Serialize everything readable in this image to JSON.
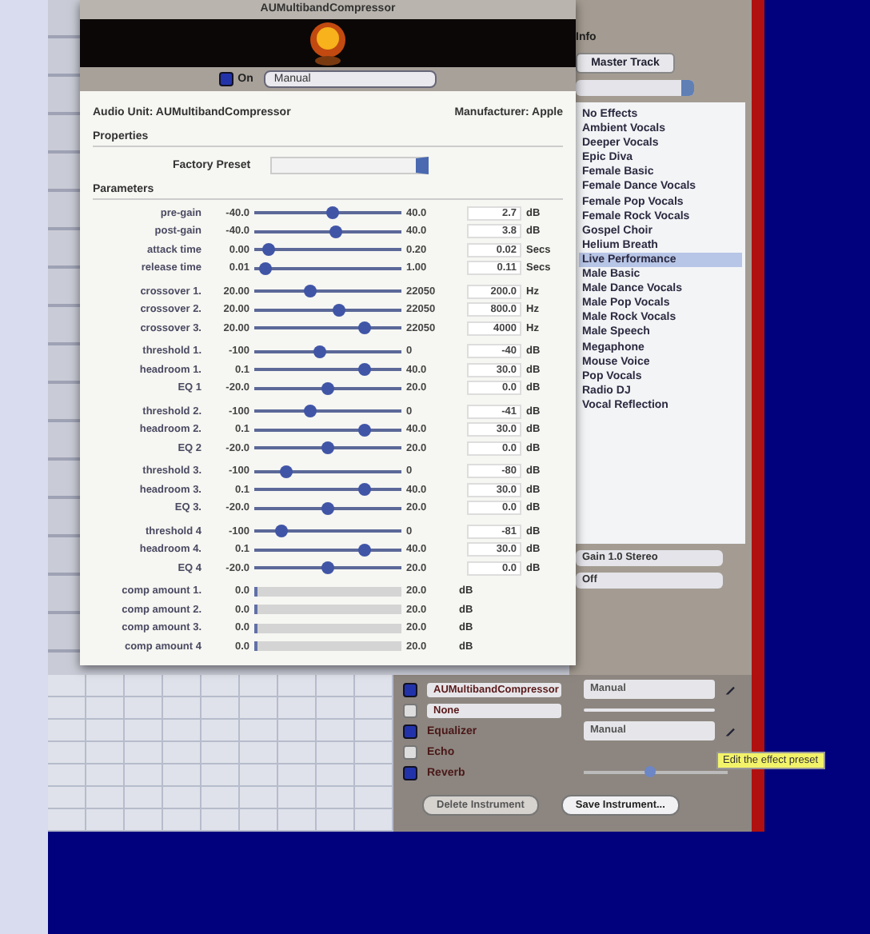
{
  "au_window": {
    "title": "AUMultibandCompressor",
    "on": {
      "label": "On",
      "checked": true
    },
    "preset_menu": "Manual",
    "audio_unit": "Audio Unit: AUMultibandCompressor",
    "manufacturer": "Manufacturer: Apple",
    "properties_heading": "Properties",
    "factory_preset_label": "Factory Preset",
    "parameters_heading": "Parameters",
    "parameter_groups": [
      [
        {
          "label": "pre-gain",
          "min": "-40.0",
          "max": "40.0",
          "level": 0.53,
          "value": "2.7",
          "unit": "dB"
        },
        {
          "label": "post-gain",
          "min": "-40.0",
          "max": "40.0",
          "level": 0.55,
          "value": "3.8",
          "unit": "dB"
        },
        {
          "label": "attack time",
          "min": "0.00",
          "max": "0.20",
          "level": 0.1,
          "value": "0.02",
          "unit": "Secs"
        },
        {
          "label": "release time",
          "min": "0.01",
          "max": "1.00",
          "level": 0.08,
          "value": "0.11",
          "unit": "Secs"
        }
      ],
      [
        {
          "label": "crossover 1.",
          "min": "20.00",
          "max": "22050",
          "level": 0.38,
          "value": "200.0",
          "unit": "Hz"
        },
        {
          "label": "crossover 2.",
          "min": "20.00",
          "max": "22050",
          "level": 0.58,
          "value": "800.0",
          "unit": "Hz"
        },
        {
          "label": "crossover 3.",
          "min": "20.00",
          "max": "22050",
          "level": 0.75,
          "value": "4000",
          "unit": "Hz"
        }
      ],
      [
        {
          "label": "threshold 1.",
          "min": "-100",
          "max": "0",
          "level": 0.45,
          "value": "-40",
          "unit": "dB"
        },
        {
          "label": "headroom 1.",
          "min": "0.1",
          "max": "40.0",
          "level": 0.75,
          "value": "30.0",
          "unit": "dB"
        },
        {
          "label": "EQ 1",
          "min": "-20.0",
          "max": "20.0",
          "level": 0.5,
          "value": "0.0",
          "unit": "dB"
        }
      ],
      [
        {
          "label": "threshold 2.",
          "min": "-100",
          "max": "0",
          "level": 0.38,
          "value": "-41",
          "unit": "dB"
        },
        {
          "label": "headroom 2.",
          "min": "0.1",
          "max": "40.0",
          "level": 0.75,
          "value": "30.0",
          "unit": "dB"
        },
        {
          "label": "EQ 2",
          "min": "-20.0",
          "max": "20.0",
          "level": 0.5,
          "value": "0.0",
          "unit": "dB"
        }
      ],
      [
        {
          "label": "threshold 3.",
          "min": "-100",
          "max": "0",
          "level": 0.22,
          "value": "-80",
          "unit": "dB"
        },
        {
          "label": "headroom 3.",
          "min": "0.1",
          "max": "40.0",
          "level": 0.75,
          "value": "30.0",
          "unit": "dB"
        },
        {
          "label": "EQ 3.",
          "min": "-20.0",
          "max": "20.0",
          "level": 0.5,
          "value": "0.0",
          "unit": "dB"
        }
      ],
      [
        {
          "label": "threshold 4",
          "min": "-100",
          "max": "0",
          "level": 0.18,
          "value": "-81",
          "unit": "dB"
        },
        {
          "label": "headroom 4.",
          "min": "0.1",
          "max": "40.0",
          "level": 0.75,
          "value": "30.0",
          "unit": "dB"
        },
        {
          "label": "EQ 4",
          "min": "-20.0",
          "max": "20.0",
          "level": 0.5,
          "value": "0.0",
          "unit": "dB"
        }
      ]
    ],
    "meters": [
      {
        "label": "comp amount 1.",
        "min": "0.0",
        "max": "20.0",
        "level": 0.02,
        "unit": "dB"
      },
      {
        "label": "comp amount 2.",
        "min": "0.0",
        "max": "20.0",
        "level": 0.02,
        "unit": "dB"
      },
      {
        "label": "comp amount 3.",
        "min": "0.0",
        "max": "20.0",
        "level": 0.02,
        "unit": "dB"
      },
      {
        "label": "comp amount 4",
        "min": "0.0",
        "max": "20.0",
        "level": 0.02,
        "unit": "dB"
      }
    ]
  },
  "info_panel": {
    "title": "Info",
    "track_button": "Master Track",
    "presets": [
      {
        "label": "No Effects",
        "selected": false
      },
      {
        "label": "Ambient Vocals",
        "selected": false
      },
      {
        "label": "Deeper Vocals",
        "selected": false
      },
      {
        "label": "Epic Diva",
        "selected": false
      },
      {
        "label": "Female Basic",
        "selected": false
      },
      {
        "label": "Female Dance Vocals",
        "selected": false
      },
      {
        "label": "Female Pop Vocals",
        "selected": false
      },
      {
        "label": "Female Rock Vocals",
        "selected": false
      },
      {
        "label": "Gospel Choir",
        "selected": false
      },
      {
        "label": "Helium Breath",
        "selected": false
      },
      {
        "label": "Live Performance",
        "selected": true
      },
      {
        "label": "Male Basic",
        "selected": false
      },
      {
        "label": "Male Dance Vocals",
        "selected": false
      },
      {
        "label": "Male Pop Vocals",
        "selected": false
      },
      {
        "label": "Male Rock Vocals",
        "selected": false
      },
      {
        "label": "Male Speech",
        "selected": false
      },
      {
        "label": "Megaphone",
        "selected": false
      },
      {
        "label": "Mouse Voice",
        "selected": false
      },
      {
        "label": "Pop Vocals",
        "selected": false
      },
      {
        "label": "Radio DJ",
        "selected": false
      },
      {
        "label": "Vocal Reflection",
        "selected": false
      }
    ],
    "input_menu": "Gain 1.0 Stereo",
    "monitor_menu": "Off",
    "effects": [
      {
        "kind": "menu",
        "checked": true,
        "name": "AUMultibandCompressor",
        "preset": "Manual"
      },
      {
        "kind": "menu",
        "checked": false,
        "name": "None"
      },
      {
        "kind": "plain",
        "checked": true,
        "name": "Equalizer",
        "preset": "Manual"
      },
      {
        "kind": "plain",
        "checked": false,
        "name": "Echo"
      },
      {
        "kind": "slider",
        "checked": true,
        "name": "Reverb",
        "level": 0.45
      }
    ],
    "tooltip": "Edit the effect preset",
    "buttons": [
      {
        "label": "Delete Instrument",
        "disabled": true
      },
      {
        "label": "Save Instrument...",
        "disabled": false
      }
    ]
  }
}
